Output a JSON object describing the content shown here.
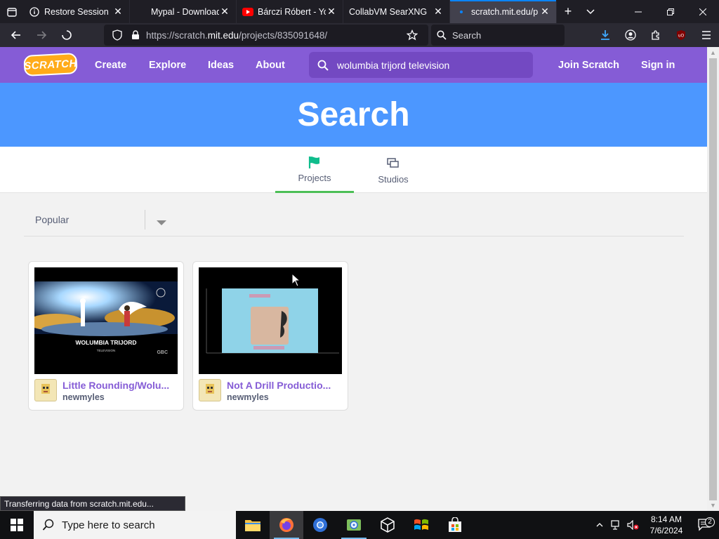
{
  "browser": {
    "tabs": [
      {
        "label": "Restore Session",
        "icon": "info-icon",
        "active": false
      },
      {
        "label": "Mypal - Download",
        "icon": "none",
        "active": false
      },
      {
        "label": "Bárczi Róbert - You",
        "icon": "youtube-icon",
        "active": false
      },
      {
        "label": "CollabVM SearXNG",
        "icon": "none",
        "active": false
      },
      {
        "label": "scratch.mit.edu/p",
        "icon": "loading-dot",
        "active": true
      }
    ],
    "url_prefix": "https://scratch.",
    "url_domain": "mit.edu",
    "url_path": "/projects/835091648/",
    "search_placeholder": "Search",
    "status_text": "Transferring data from scratch.mit.edu..."
  },
  "scratch": {
    "logo_text": "SCRATCH",
    "nav": {
      "create": "Create",
      "explore": "Explore",
      "ideas": "Ideas",
      "about": "About",
      "search_value": "wolumbia trijord television",
      "join": "Join Scratch",
      "signin": "Sign in"
    },
    "banner_title": "Search",
    "tabs": {
      "projects": "Projects",
      "studios": "Studios"
    },
    "sort_label": "Popular",
    "projects": [
      {
        "title": "Little Rounding/Wolu...",
        "author": "newmyles"
      },
      {
        "title": "Not A Drill Productio...",
        "author": "newmyles"
      }
    ],
    "colors": {
      "navbar": "#855cd6",
      "banner": "#4c97ff",
      "active_tab": "#4cbf56"
    }
  },
  "thumbnails": {
    "first_title": "WOLUMBIA TRIJORD",
    "first_subtitle": "TELEVISION",
    "first_corner": "GBC"
  },
  "taskbar": {
    "search_placeholder": "Type here to search",
    "time": "8:14 AM",
    "date": "7/6/2024",
    "notifications": "2"
  }
}
